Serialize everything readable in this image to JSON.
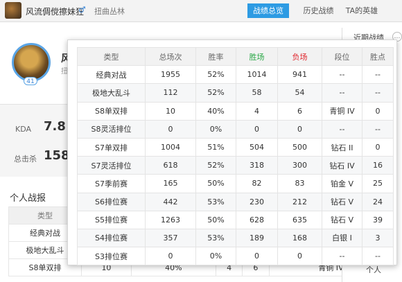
{
  "header": {
    "nickname": "风流倜傥擦妹狂",
    "gender_icon": "male-icon",
    "server": "扭曲丛林",
    "tabs": [
      "战绩总览",
      "历史战绩",
      "TA的英雄"
    ]
  },
  "profile": {
    "name_partial": "风",
    "sub_partial": "扭",
    "level": "41",
    "kda_label": "KDA",
    "kda_value": "7.8",
    "kills_label": "总击杀",
    "kills_value": "158"
  },
  "right_panel": {
    "title_partial": "近期战绩",
    "footer_partial": "个人"
  },
  "personal_section": {
    "title": "个人战报",
    "header_label": "类型",
    "rows": [
      [
        "经典对战",
        "",
        "",
        "",
        "",
        "",
        ""
      ],
      [
        "极地大乱斗",
        "",
        "",
        "",
        "",
        "",
        ""
      ],
      [
        "S8单双排",
        "10",
        "40%",
        "4",
        "6",
        "青铜 IV",
        ""
      ]
    ]
  },
  "popup_table": {
    "headers": [
      "类型",
      "总场次",
      "胜率",
      "胜场",
      "负场",
      "段位",
      "胜点"
    ],
    "rows": [
      [
        "经典对战",
        "1955",
        "52%",
        "1014",
        "941",
        "--",
        "--"
      ],
      [
        "极地大乱斗",
        "112",
        "52%",
        "58",
        "54",
        "--",
        "--"
      ],
      [
        "S8单双排",
        "10",
        "40%",
        "4",
        "6",
        "青铜 IV",
        "0"
      ],
      [
        "S8灵活排位",
        "0",
        "0%",
        "0",
        "0",
        "--",
        "--"
      ],
      [
        "S7单双排",
        "1004",
        "51%",
        "504",
        "500",
        "钻石 II",
        "0"
      ],
      [
        "S7灵活排位",
        "618",
        "52%",
        "318",
        "300",
        "钻石 IV",
        "16"
      ],
      [
        "S7季前赛",
        "165",
        "50%",
        "82",
        "83",
        "铂金 V",
        "25"
      ],
      [
        "S6排位赛",
        "442",
        "53%",
        "230",
        "212",
        "钻石 V",
        "24"
      ],
      [
        "S5排位赛",
        "1263",
        "50%",
        "628",
        "635",
        "钻石 V",
        "39"
      ],
      [
        "S4排位赛",
        "357",
        "53%",
        "189",
        "168",
        "白银 I",
        "3"
      ],
      [
        "S3排位赛",
        "0",
        "0%",
        "0",
        "0",
        "--",
        "--"
      ]
    ]
  },
  "colors": {
    "accent": "#2d9be3",
    "win": "#28a745",
    "loss": "#e0242b"
  }
}
